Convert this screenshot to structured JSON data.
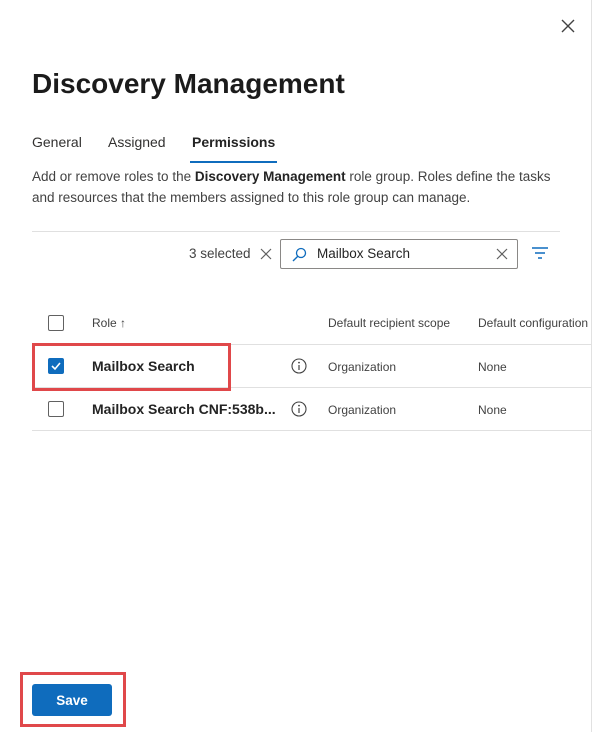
{
  "panel": {
    "title": "Discovery Management",
    "close_icon": "close-icon"
  },
  "tabs": [
    {
      "label": "General",
      "active": false
    },
    {
      "label": "Assigned",
      "active": false
    },
    {
      "label": "Permissions",
      "active": true
    }
  ],
  "description": {
    "prefix": "Add or remove roles to the ",
    "group_name": "Discovery Management",
    "suffix": " role group. Roles define the tasks and resources that the members assigned to this role group can manage."
  },
  "toolbar": {
    "selected_count": "3 selected",
    "search_value": "Mailbox Search",
    "icons": [
      "search-icon",
      "clear-icon",
      "filter-icon"
    ]
  },
  "table": {
    "columns": {
      "role": "Role ↑",
      "scope": "Default recipient scope",
      "config": "Default configuration"
    },
    "rows": [
      {
        "name": "Mailbox Search",
        "scope": "Organization",
        "config": "None",
        "checked": true
      },
      {
        "name": "Mailbox Search CNF:538b...",
        "scope": "Organization",
        "config": "None",
        "checked": false
      }
    ]
  },
  "footer": {
    "save_label": "Save"
  },
  "colors": {
    "accent": "#0f6cbd",
    "highlight": "#e0484a"
  }
}
